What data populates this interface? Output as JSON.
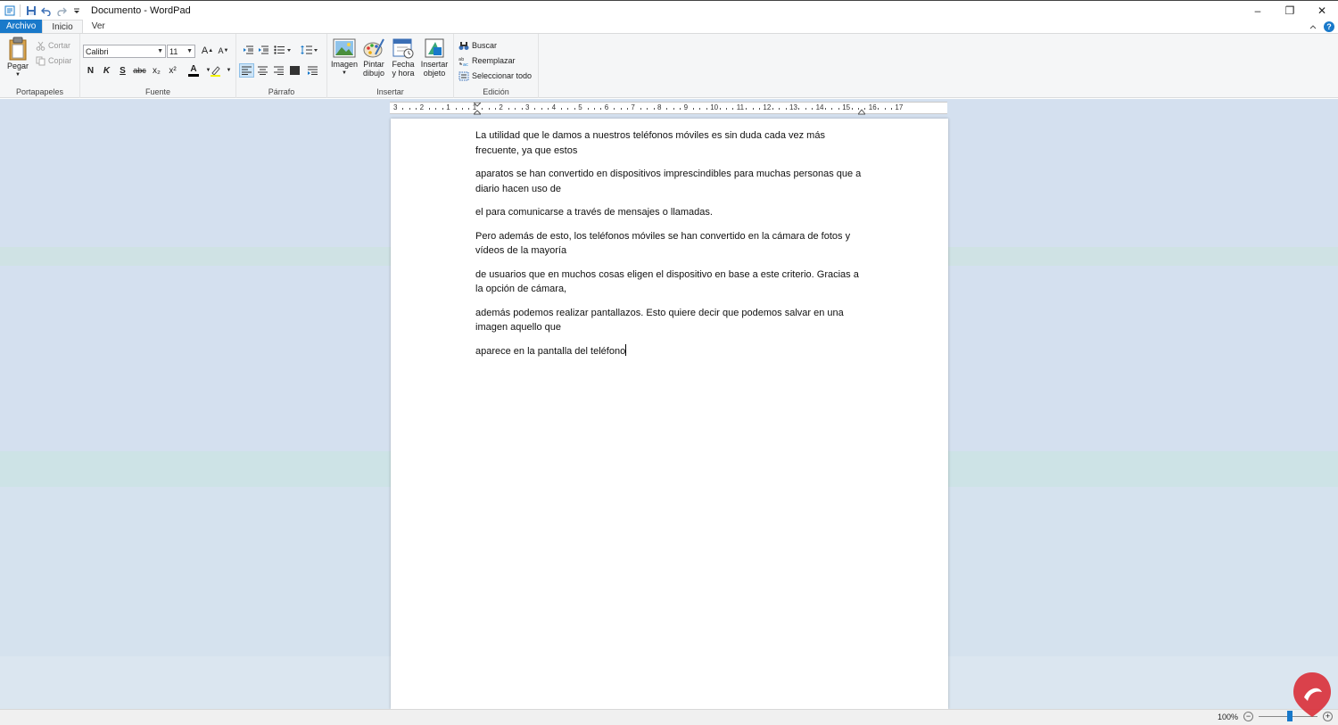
{
  "app": {
    "title": "Documento - WordPad"
  },
  "window_controls": {
    "minimize": "–",
    "restore": "❐",
    "close": "✕"
  },
  "tabs": {
    "file": "Archivo",
    "home": "Inicio",
    "view": "Ver"
  },
  "ribbon": {
    "clipboard": {
      "label": "Portapapeles",
      "paste": "Pegar",
      "cut": "Cortar",
      "copy": "Copiar"
    },
    "font": {
      "label": "Fuente",
      "family": "Calibri",
      "size": "11",
      "bold": "N",
      "italic": "K",
      "underline": "S",
      "strike": "abc",
      "subscript": "x₂",
      "superscript": "x²",
      "font_color_glyph": "A",
      "grow": "A",
      "shrink": "A"
    },
    "paragraph": {
      "label": "Párrafo"
    },
    "insert": {
      "label": "Insertar",
      "image": "Imagen",
      "paint_line1": "Pintar",
      "paint_line2": "dibujo",
      "datetime_line1": "Fecha",
      "datetime_line2": "y hora",
      "object_line1": "Insertar",
      "object_line2": "objeto"
    },
    "editing": {
      "label": "Edición",
      "find": "Buscar",
      "replace": "Reemplazar",
      "select_all": "Seleccionar todo"
    }
  },
  "ruler": {
    "labels": [
      "3",
      "2",
      "1",
      "1",
      "2",
      "3",
      "4",
      "5",
      "6",
      "7",
      "8",
      "9",
      "10",
      "11",
      "12",
      "13",
      "14",
      "15",
      "16",
      "17"
    ]
  },
  "document": {
    "paragraphs": [
      "La utilidad que le damos a nuestros teléfonos móviles es sin duda cada vez más frecuente, ya que estos",
      "aparatos se han convertido en dispositivos imprescindibles para muchas personas que a diario hacen uso de",
      "el para comunicarse a través de mensajes o llamadas.",
      "Pero además de esto, los teléfonos móviles se han convertido en la cámara de fotos y vídeos de la mayoría",
      "de usuarios que en muchos cosas eligen el dispositivo en base a este criterio. Gracias a la opción de cámara,",
      "además podemos realizar pantallazos. Esto quiere decir que podemos salvar en una imagen aquello que",
      "aparece en la pantalla del teléfono"
    ]
  },
  "statusbar": {
    "zoom": "100%",
    "zoom_out": "−",
    "zoom_in": "+"
  },
  "colors": {
    "accent": "#1979ca",
    "workspace": "#d4e0ef",
    "ribbon_bg": "#f5f6f7"
  }
}
